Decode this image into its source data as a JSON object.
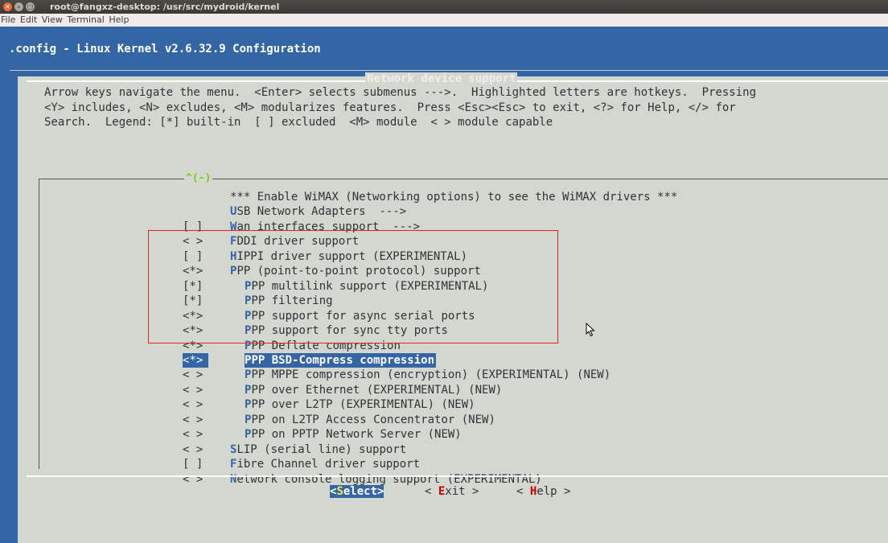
{
  "window": {
    "title": "root@fangxz-desktop: /usr/src/mydroid/kernel"
  },
  "menubar": [
    "File",
    "Edit",
    "View",
    "Terminal",
    "Help"
  ],
  "config_header": ".config - Linux Kernel v2.6.32.9 Configuration",
  "dialog": {
    "title": "Network device support",
    "help_lines": [
      "Arrow keys navigate the menu.  <Enter> selects submenus --->.  Highlighted letters are hotkeys.  Pressing",
      "<Y> includes, <N> excludes, <M> modularizes features.  Press <Esc><Esc> to exit, <?> for Help, </> for",
      "Search.  Legend: [*] built-in  [ ] excluded  <M> module  < > module capable"
    ],
    "scroll_indicator": "^(-)",
    "items": [
      {
        "mark": "",
        "hotkey": "",
        "rest": "*** Enable WiMAX (Networking options) to see the WiMAX drivers ***",
        "indent": 0
      },
      {
        "mark": "",
        "hotkey": "U",
        "rest": "SB Network Adapters  --->",
        "indent": 0
      },
      {
        "mark": "[ ]",
        "hotkey": "W",
        "rest": "an interfaces support  --->",
        "indent": 0
      },
      {
        "mark": "< >",
        "hotkey": "F",
        "rest": "DDI driver support",
        "indent": 0
      },
      {
        "mark": "[ ]",
        "hotkey": "H",
        "rest": "IPPI driver support (EXPERIMENTAL)",
        "indent": 0
      },
      {
        "mark": "<*>",
        "hotkey": "P",
        "rest": "PP (point-to-point protocol) support",
        "indent": 0
      },
      {
        "mark": "[*]",
        "hotkey": "P",
        "rest": "PP multilink support (EXPERIMENTAL)",
        "indent": 1
      },
      {
        "mark": "[*]",
        "hotkey": "P",
        "rest": "PP filtering",
        "indent": 1
      },
      {
        "mark": "<*>",
        "hotkey": "P",
        "rest": "PP support for async serial ports",
        "indent": 1
      },
      {
        "mark": "<*>",
        "hotkey": "P",
        "rest": "PP support for sync tty ports",
        "indent": 1
      },
      {
        "mark": "<*>",
        "hotkey": "P",
        "rest": "PP Deflate compression",
        "indent": 1
      },
      {
        "mark": "<*>",
        "hotkey": "P",
        "rest": "PP BSD-Compress compression",
        "indent": 1,
        "selected": true
      },
      {
        "mark": "< >",
        "hotkey": "P",
        "rest": "PP MPPE compression (encryption) (EXPERIMENTAL) (NEW)",
        "indent": 1
      },
      {
        "mark": "< >",
        "hotkey": "P",
        "rest": "PP over Ethernet (EXPERIMENTAL) (NEW)",
        "indent": 1
      },
      {
        "mark": "< >",
        "hotkey": "P",
        "rest": "PP over L2TP (EXPERIMENTAL) (NEW)",
        "indent": 1
      },
      {
        "mark": "< >",
        "hotkey": "P",
        "rest": "PP on L2TP Access Concentrator (NEW)",
        "indent": 1
      },
      {
        "mark": "< >",
        "hotkey": "P",
        "rest": "PP on PPTP Network Server (NEW)",
        "indent": 1
      },
      {
        "mark": "< >",
        "hotkey": "S",
        "rest": "LIP (serial line) support",
        "indent": 0
      },
      {
        "mark": "[ ]",
        "hotkey": "F",
        "rest": "ibre Channel driver support",
        "indent": 0
      },
      {
        "mark": "< >",
        "hotkey": "N",
        "rest": "etwork console logging support (EXPERIMENTAL)",
        "indent": 0
      }
    ],
    "buttons": {
      "select": {
        "pre": "<",
        "hotkey": "S",
        "post": "elect>"
      },
      "exit": {
        "pre": "< ",
        "hotkey": "E",
        "post": "xit >"
      },
      "help": {
        "pre": "< ",
        "hotkey": "H",
        "post": "elp >"
      }
    }
  },
  "colors": {
    "terminal_bg": "#3465a4",
    "dialog_bg": "#d3d7cf",
    "hotkey": "#3465a4",
    "annotation_box": "#e62222"
  }
}
